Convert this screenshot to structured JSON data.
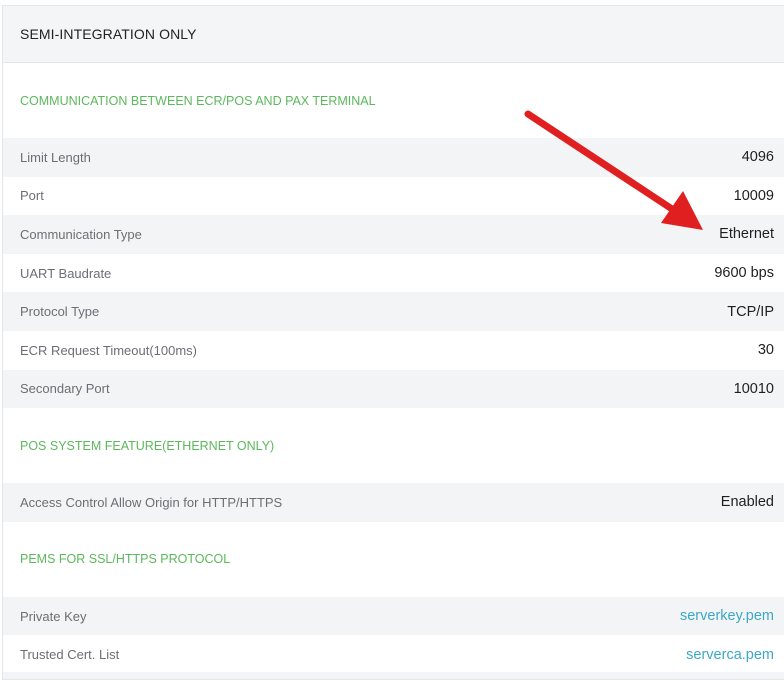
{
  "panel": {
    "title": "SEMI-INTEGRATION ONLY"
  },
  "sections": [
    {
      "title": "COMMUNICATION BETWEEN ECR/POS AND PAX TERMINAL",
      "rows": [
        {
          "label": "Limit Length",
          "value": "4096"
        },
        {
          "label": "Port",
          "value": "10009"
        },
        {
          "label": "Communication Type",
          "value": "Ethernet"
        },
        {
          "label": "UART Baudrate",
          "value": "9600 bps"
        },
        {
          "label": "Protocol Type",
          "value": "TCP/IP"
        },
        {
          "label": "ECR Request Timeout(100ms)",
          "value": "30"
        },
        {
          "label": "Secondary Port",
          "value": "10010"
        }
      ]
    },
    {
      "title": "POS SYSTEM FEATURE(ETHERNET ONLY)",
      "rows": [
        {
          "label": "Access Control Allow Origin for HTTP/HTTPS",
          "value": "Enabled"
        }
      ]
    },
    {
      "title": "PEMS FOR SSL/HTTPS PROTOCOL",
      "rows": [
        {
          "label": "Private Key",
          "value": "serverkey.pem"
        },
        {
          "label": "Trusted Cert. List",
          "value": "serverca.pem"
        }
      ]
    }
  ],
  "colors": {
    "section_title": "#5cb85c",
    "link": "#3aa8c8",
    "annotation_arrow": "#e02020"
  },
  "icons": {
    "annotation": "red-arrow-icon"
  }
}
